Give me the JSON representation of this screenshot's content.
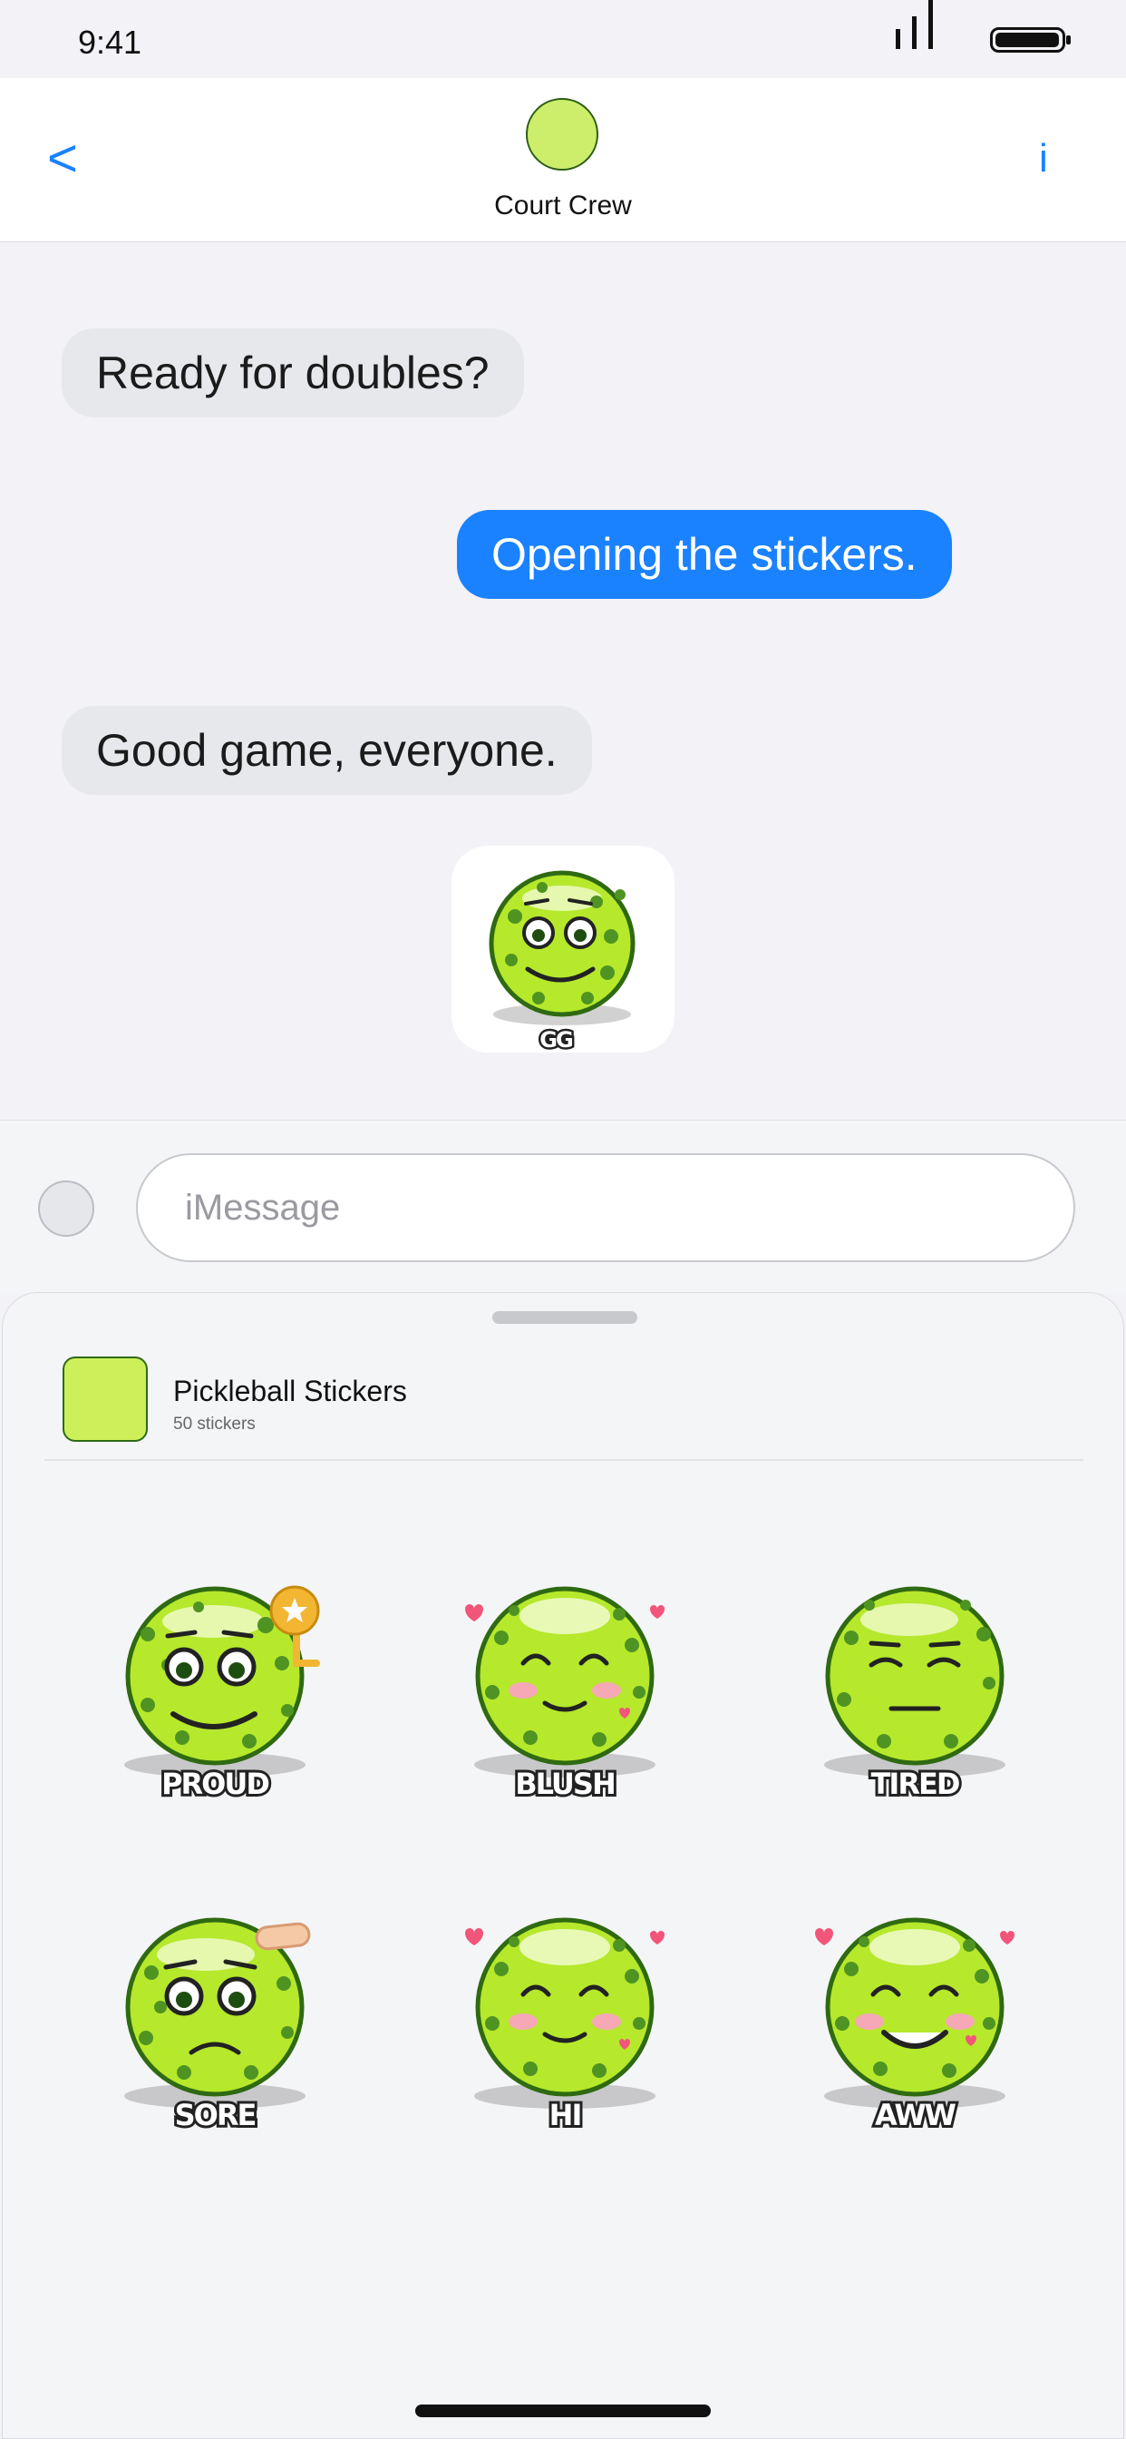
{
  "status": {
    "time": "9:41"
  },
  "header": {
    "back": "<",
    "contact_name": "Court Crew",
    "info": "i"
  },
  "messages": [
    {
      "direction": "incoming",
      "text": "Ready for doubles?"
    },
    {
      "direction": "outgoing",
      "text": "Opening the stickers."
    },
    {
      "direction": "incoming",
      "text": "Good game, everyone."
    }
  ],
  "sent_sticker": {
    "caption": "GG"
  },
  "composer": {
    "placeholder": "iMessage"
  },
  "drawer": {
    "pack_title": "Pickleball Stickers",
    "pack_count": "50 stickers",
    "stickers": [
      {
        "label": "PROUD",
        "prop": "medal"
      },
      {
        "label": "BLUSH",
        "prop": "hearts"
      },
      {
        "label": "TIRED",
        "prop": "none"
      },
      {
        "label": "SORE",
        "prop": "bandage"
      },
      {
        "label": "HI",
        "prop": "hearts"
      },
      {
        "label": "AWW",
        "prop": "hearts"
      }
    ]
  },
  "colors": {
    "accent": "#1a82ff",
    "ball": "#b6e82c",
    "ball_outline": "#2f6a12",
    "incoming_bubble": "#e7e8eb",
    "outgoing_bubble": "#1a82ff"
  }
}
